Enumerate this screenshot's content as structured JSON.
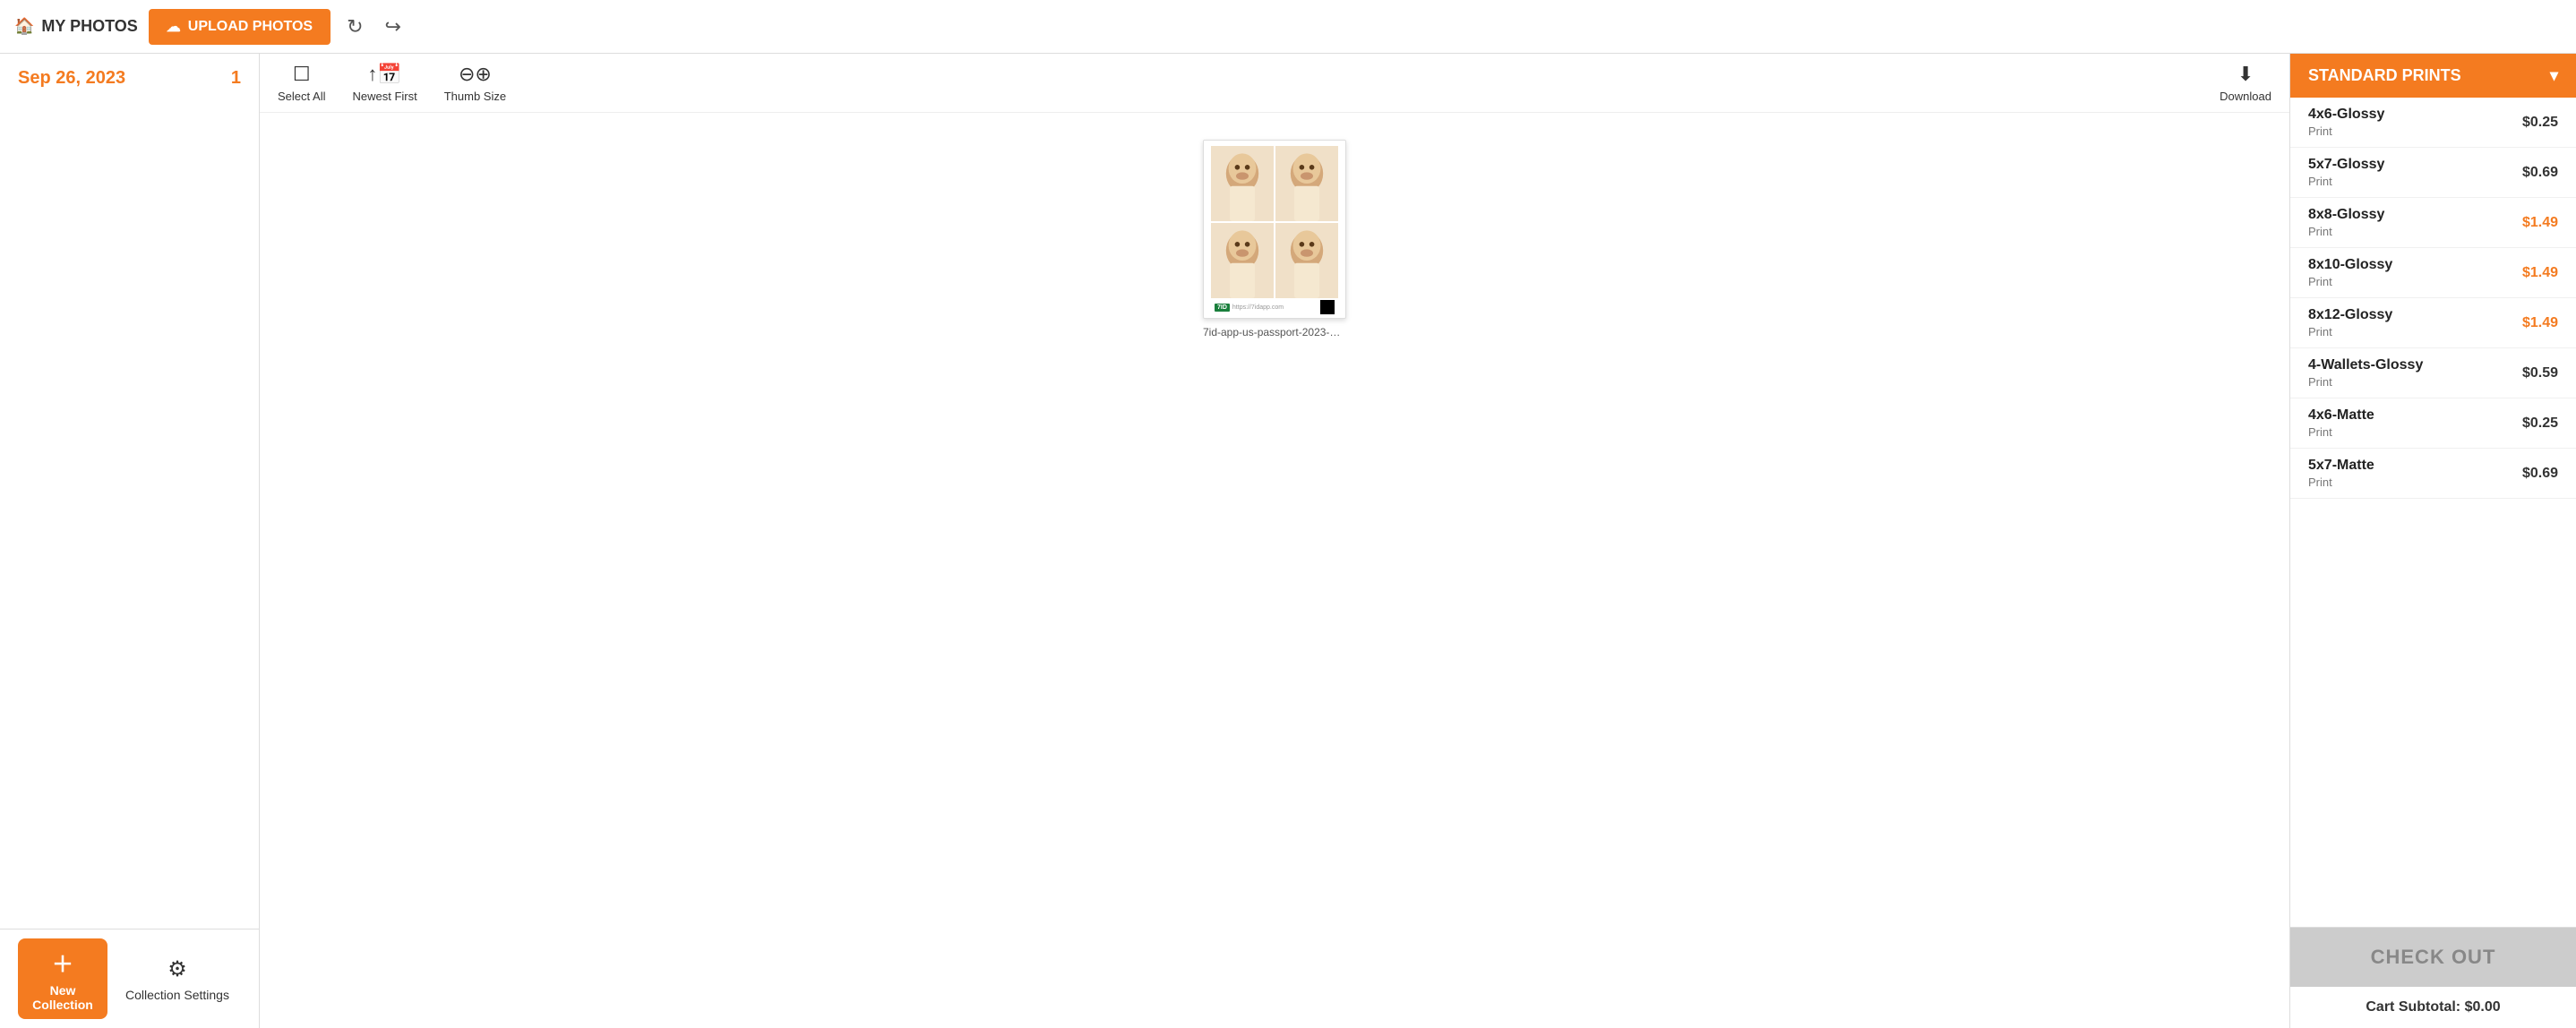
{
  "header": {
    "my_photos_label": "MY PHOTOS",
    "upload_label": "UPLOAD PHOTOS",
    "refresh_icon": "↻",
    "share_icon": "↪"
  },
  "sidebar": {
    "date_label": "Sep 26, 2023",
    "photo_count": "1",
    "new_collection_label": "New Collection",
    "collection_settings_label": "Collection Settings"
  },
  "toolbar": {
    "select_all_label": "Select All",
    "newest_first_label": "Newest First",
    "thumb_size_label": "Thumb Size",
    "download_label": "Download"
  },
  "photo": {
    "filename": "7id-app-us-passport-2023-09...",
    "logo_text": "7ID"
  },
  "right_panel": {
    "standard_prints_label": "STANDARD PRINTS",
    "prints": [
      {
        "name": "4x6-Glossy",
        "type": "Print",
        "price": "$0.25",
        "highlight": false
      },
      {
        "name": "5x7-Glossy",
        "type": "Print",
        "price": "$0.69",
        "highlight": false
      },
      {
        "name": "8x8-Glossy",
        "type": "Print",
        "price": "$1.49",
        "highlight": true
      },
      {
        "name": "8x10-Glossy",
        "type": "Print",
        "price": "$1.49",
        "highlight": true
      },
      {
        "name": "8x12-Glossy",
        "type": "Print",
        "price": "$1.49",
        "highlight": true
      },
      {
        "name": "4-Wallets-Glossy",
        "type": "Print",
        "price": "$0.59",
        "highlight": false
      },
      {
        "name": "4x6-Matte",
        "type": "Print",
        "price": "$0.25",
        "highlight": false
      },
      {
        "name": "5x7-Matte",
        "type": "Print",
        "price": "$0.69",
        "highlight": false
      }
    ],
    "checkout_label": "CHECK OUT",
    "cart_subtotal_label": "Cart Subtotal: $0.00"
  }
}
